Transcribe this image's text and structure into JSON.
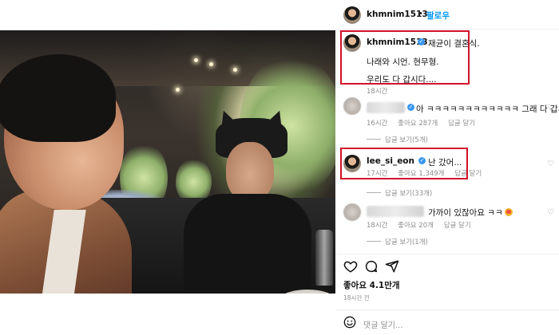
{
  "header": {
    "username": "khmnim1513",
    "separator": "•",
    "follow_label": "팔로우"
  },
  "caption": {
    "username": "khmnim1513",
    "line1": "재균이 결혼식.",
    "line2": "나래와 시언. 현무형.",
    "line3": "우리도 다 갑시다....",
    "time": "18시간"
  },
  "comments": [
    {
      "text": "아 ㅋㅋㅋㅋㅋㅋㅋㅋㅋㅋㅋㅋ 그래 다 갑시다",
      "time": "16시간",
      "likes": "좋아요 287개",
      "reply": "답글 달기",
      "view_replies": "답글 보기(5개)"
    },
    {
      "username": "lee_si_eon",
      "text": "난 갔어...",
      "time": "17시간",
      "likes": "좋아요 1,349개",
      "reply": "답글 달기",
      "view_replies": "답글 보기(33개)"
    },
    {
      "text": "가까이 있잖아요 ㅋㅋ",
      "time": "18시간",
      "likes": "좋아요 20개",
      "reply": "답글 달기",
      "view_replies": "답글 보기(1개)"
    }
  ],
  "footer": {
    "likes": "좋아요 4.1만개",
    "time": "18시간 전",
    "comment_placeholder": "댓글 달기..."
  },
  "icons": {
    "like": "heart-icon",
    "comment": "comment-icon",
    "share": "share-icon",
    "emoji": "smile-icon"
  },
  "colors": {
    "follow": "#0095f6",
    "highlight_box": "#d3102c",
    "verified": "#3897f0"
  }
}
